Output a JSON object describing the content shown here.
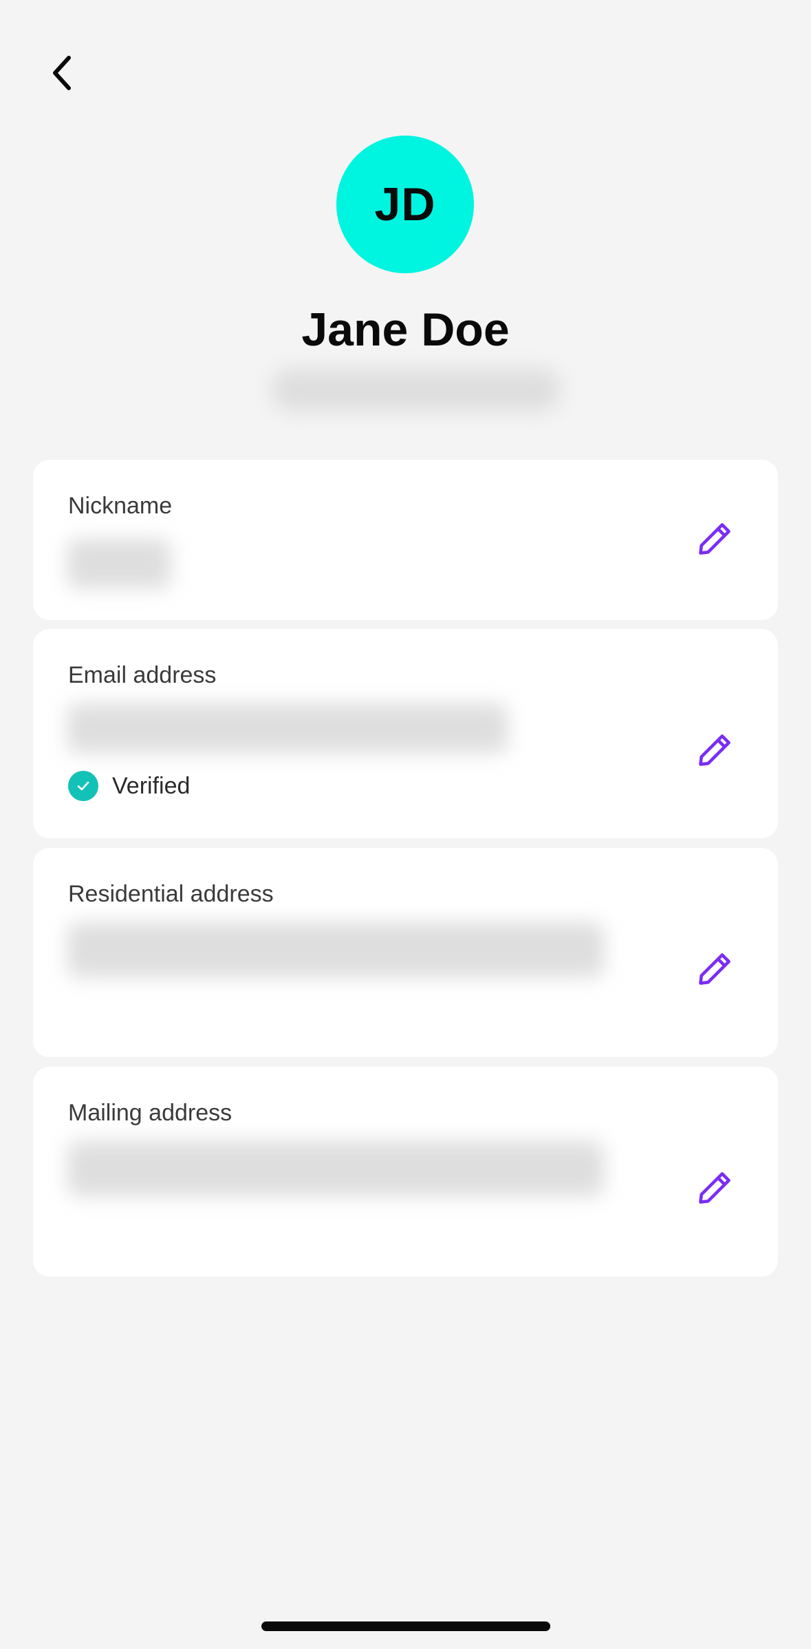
{
  "header": {
    "back_label": "back"
  },
  "profile": {
    "initials": "JD",
    "name": "Jane Doe",
    "avatar_color": "#00f5e0"
  },
  "cards": {
    "nickname": {
      "label": "Nickname"
    },
    "email": {
      "label": "Email address",
      "status": "Verified"
    },
    "residential": {
      "label": "Residential address"
    },
    "mailing": {
      "label": "Mailing address"
    }
  },
  "colors": {
    "accent": "#7b2cf5",
    "verified": "#13c2b7",
    "background": "#f4f4f4"
  },
  "icons": {
    "back": "chevron-left-icon",
    "edit": "pencil-icon",
    "verified": "check-circle-icon"
  }
}
